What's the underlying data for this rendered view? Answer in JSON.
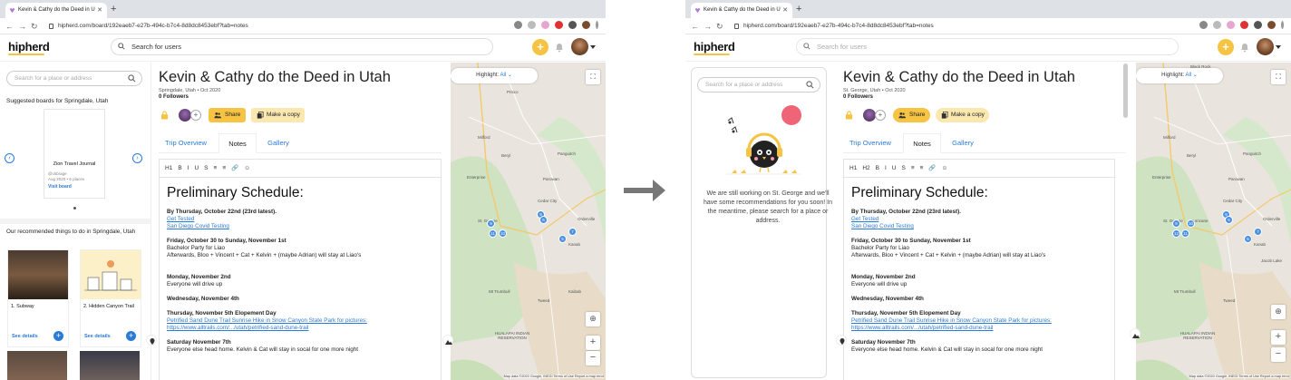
{
  "browser": {
    "tab_title": "Kevin & Cathy do the Deed in U",
    "url": "hipherd.com/board/192eaeb7-e27b-494c-b7c4-8d8dc8453ebf?tab=notes"
  },
  "app": {
    "logo": "hipherd",
    "search_placeholder_left": "Search for users",
    "search_placeholder_right": "Search for users"
  },
  "left": {
    "sidebar": {
      "place_placeholder": "Search for a place or address",
      "suggested_title": "Suggested boards for Springdale, Utah",
      "board": {
        "title": "Zion Travel Journal",
        "user": "@ckbrage",
        "meta": "Aug 2020 • 6 places",
        "link": "Visit board"
      },
      "rec_title": "Our recommended things to do in Springdale, Utah",
      "things": [
        {
          "name": "1. Subway",
          "link": "See details"
        },
        {
          "name": "2. Hidden Canyon Trail",
          "link": "See details"
        }
      ]
    },
    "board": {
      "title": "Kevin & Cathy do the Deed in Utah",
      "meta": "Springdale, Utah • Oct 2020",
      "followers": "0 Followers",
      "share": "Share",
      "copy": "Make a copy"
    }
  },
  "right": {
    "sidebar": {
      "place_placeholder": "Search for a place or address",
      "empty_message": "We are still working on St. George and we'll have some recommendations for you soon! In the meantime, please search for a place or address."
    },
    "board": {
      "title": "Kevin & Cathy do the Deed in Utah",
      "meta": "St. George, Utah • Oct 2020",
      "followers": "0 Followers",
      "share": "Share",
      "copy": "Make a copy"
    }
  },
  "tabs": [
    "Trip Overview",
    "Notes",
    "Gallery"
  ],
  "toolbar_left": [
    "H1",
    "B",
    "I",
    "U",
    "S",
    "≡",
    "≡",
    "🔗",
    "☺"
  ],
  "toolbar_right": [
    "H1",
    "H2",
    "B",
    "I",
    "U",
    "S",
    "≡",
    "≡",
    "🔗",
    "☺"
  ],
  "doc": {
    "heading": "Preliminary Schedule:",
    "l1": "By Thursday, October 22nd (23rd latest).",
    "l2": "Get Tested",
    "l3": "San Diego Covid Testing",
    "l4": "Friday, October 30 to Sunday, November 1st",
    "l5": "Bachelor Party for Liao",
    "l6": "Afterwards, Bloo + Vincent + Cat + Kelvin + (maybe Adrian) will stay at Liao's",
    "l7": "Monday, November 2nd",
    "l8": "Everyone will drive up",
    "l9": "Wednesday, November 4th",
    "l10": "Thursday, November 5th Elopement Day",
    "l11": "Petrified Sand Dune Trail Sunrise Hike in Snow Canyon State Park for pictures:",
    "l12": "https://www.alltrails.com/.../utah/petrified-sand-dune-trail",
    "l13": "Saturday November 7th",
    "l14": "Everyone else head home. Kelvin & Cat will stay in socal for one more night"
  },
  "map": {
    "highlight_label": "Highlight:",
    "highlight_value": "All",
    "labels_left": [
      "Prisco",
      "Milford",
      "Beryl",
      "Panguitch",
      "Parowan",
      "Enterprise",
      "Cedar City",
      "St. George",
      "Orderville",
      "Kanab",
      "Mt Trumbull",
      "Tweed",
      "HUALAPAI INDIAN RESERVATION",
      "Kaibab"
    ],
    "labels_right": [
      "Black Rock",
      "Milford",
      "Beryl",
      "Panguitch",
      "Parowan",
      "Enterprise",
      "Cedar City",
      "St. George",
      "Hurricane",
      "Orderville",
      "Kanab",
      "Jacob Lake",
      "Mt Trumbull",
      "Tweed",
      "HUALAPAI INDIAN RESERVATION"
    ],
    "footer": "Map data ©2020 Google, INEGI   Terms of Use   Report a map error",
    "markers_left": [
      "9",
      "11",
      "10",
      "8",
      "6",
      "7",
      "5"
    ],
    "markers_right": [
      "9",
      "12",
      "11",
      "10",
      "8",
      "6",
      "7",
      "5"
    ]
  },
  "colors": {
    "accent": "#f6c343",
    "link": "#2b7bd6",
    "marker": "#4a90e2",
    "arrow": "#777777"
  }
}
